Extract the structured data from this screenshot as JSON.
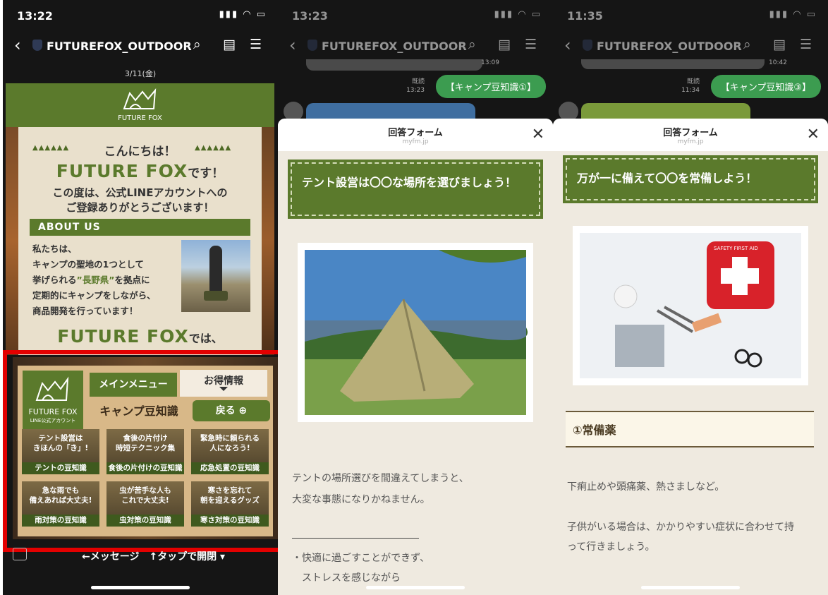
{
  "colors": {
    "brand_green": "#5b7a2c",
    "chat_bubble": "#3c9c50",
    "highlight_border": "#e30000"
  },
  "panel1": {
    "time": "13:22",
    "account": "FUTUREFOX_OUTDOOR",
    "date": "3/11(金)",
    "card": {
      "brand": "FUTURE FOX",
      "hello": "こんにちは！",
      "brand_big": "FUTURE FOX",
      "brand_suffix": "です！",
      "thanks_1": "この度は、公式LINEアカウントへの",
      "thanks_2": "ご登録ありがとうございます！",
      "about_title": "ABOUT US",
      "about_1": "私たちは、",
      "about_2": "キャンプの聖地の1つとして",
      "about_3a": "挙げられる",
      "about_3b": "”長野県”",
      "about_3c": "を拠点に",
      "about_4": "定期的にキャンプをしながら、",
      "about_5": "商品開発を行っています！",
      "ff_big": "FUTURE FOX",
      "ff_suffix": "では、"
    },
    "richmenu": {
      "logo_name": "FUTURE FOX",
      "logo_sub": "LINE公式アカウント",
      "tab_main": "メインメニュー",
      "tab_deals": "お得情報",
      "section_title": "キャンプ豆知識",
      "back_button": "戻る ⊕",
      "tiles": [
        {
          "top1": "テント設営は",
          "top2": "きほんの「き」!",
          "label": "テントの豆知識"
        },
        {
          "top1": "食後の片付け",
          "top2": "時短テクニック集",
          "label": "食後の片付けの豆知識"
        },
        {
          "top1": "緊急時に頼られる",
          "top2": "人になろう!",
          "label": "応急処置の豆知識"
        },
        {
          "top1": "急な雨でも",
          "top2": "備えあれば大丈夫!",
          "label": "雨対策の豆知識"
        },
        {
          "top1": "虫が苦手な人も",
          "top2": "これで大丈夫!",
          "label": "虫対策の豆知識"
        },
        {
          "top1": "寒さを忘れて",
          "top2": "朝を迎えるグッズ",
          "label": "寒さ対策の豆知識"
        }
      ]
    },
    "bottom": "←メッセージ　↑タップで開閉 ▾"
  },
  "panel2": {
    "time": "13:23",
    "account": "FUTUREFOX_OUTDOOR",
    "prev_time": "13:09",
    "read": "既読",
    "sent_time": "13:23",
    "message": "【キャンプ豆知識①】",
    "form_title": "回答フォーム",
    "form_domain": "myfm.jp",
    "question": "テント設営は〇〇な場所を選びましょう！",
    "desc_1": "テントの場所選びを間違えてしまうと、",
    "desc_2": "大変な事態になりかねません。",
    "bullet_1": "・快適に過ごすことができず、",
    "bullet_2": "ストレスを感じながら"
  },
  "panel3": {
    "time": "11:35",
    "account": "FUTUREFOX_OUTDOOR",
    "prev_time": "10:42",
    "read": "既読",
    "sent_time": "11:34",
    "message": "【キャンプ豆知識③】",
    "form_title": "回答フォーム",
    "form_domain": "myfm.jp",
    "question": "万が一に備えて〇〇を常備しよう！",
    "kit_label": "SAFETY FIRST AID",
    "section": "①常備薬",
    "desc_1": "下痢止めや頭痛薬、熱さましなど。",
    "desc_2": "子供がいる場合は、かかりやすい症状に合わせて持",
    "desc_3": "って行きましょう。"
  }
}
